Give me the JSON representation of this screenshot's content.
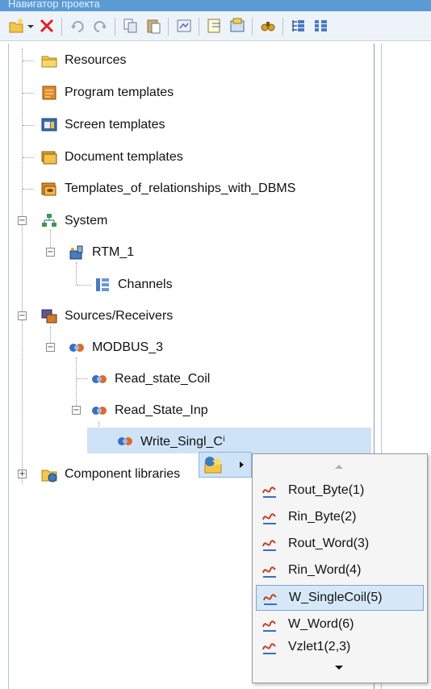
{
  "window": {
    "title": "Навигатор проекта"
  },
  "toolbar": {
    "buttons": [
      "new-item-icon",
      "delete-icon",
      "undo-icon",
      "redo-icon",
      "copy-icon",
      "paste-icon",
      "properties-icon",
      "import-icon",
      "export-icon",
      "find-icon",
      "expand-tree-icon",
      "collapse-tree-icon"
    ]
  },
  "tree": {
    "resources": "Resources",
    "program_templates": "Program templates",
    "screen_templates": "Screen templates",
    "document_templates": "Document templates",
    "relationships_templates": "Templates_of_relationships_with_DBMS",
    "system": "System",
    "rtm": "RTM_1",
    "channels": "Channels",
    "sources_receivers": "Sources/Receivers",
    "modbus": "MODBUS_3",
    "read_state_coil": "Read_state_Coil",
    "read_state_inp": "Read_State_Inp",
    "write_singl": "Write_Singl_Cⁱ",
    "component_libraries": "Component libraries"
  },
  "context_menu": {
    "items": [
      {
        "label": "Rout_Byte(1)"
      },
      {
        "label": "Rin_Byte(2)"
      },
      {
        "label": "Rout_Word(3)"
      },
      {
        "label": "Rin_Word(4)"
      },
      {
        "label": "W_SingleCoil(5)"
      },
      {
        "label": "W_Word(6)"
      },
      {
        "label": "Vzlet1(2,3)"
      }
    ]
  },
  "colors": {
    "selection": "#cfe3f7",
    "highlight": "#d6e8f8",
    "accent": "#5b9bd5"
  }
}
